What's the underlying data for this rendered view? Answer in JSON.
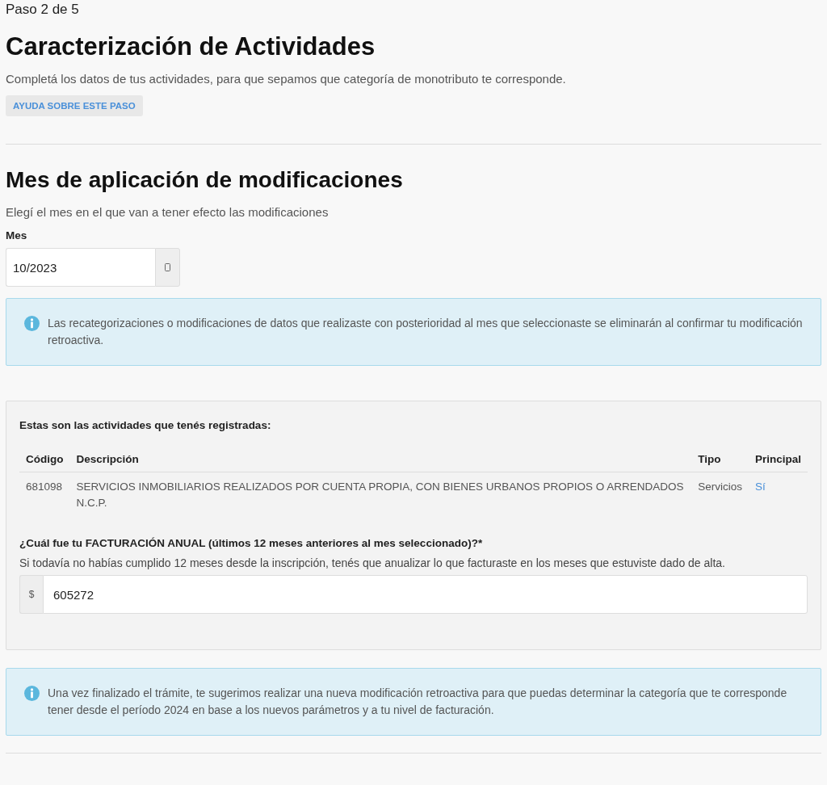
{
  "step": "Paso 2 de 5",
  "title": "Caracterización de Actividades",
  "intro": "Completá los datos de tus actividades, para que sepamos que categoría de monotributo te corresponde.",
  "help_button": "AYUDA SOBRE ESTE PASO",
  "month_section": {
    "title": "Mes de aplicación de modificaciones",
    "description": "Elegí el mes en el que van a tener efecto las modificaciones",
    "field": {
      "label": "Mes",
      "value": "10/2023"
    },
    "alert": "Las recategorizaciones o modificaciones de datos que realizaste con posterioridad al mes que seleccionaste se eliminarán al confirmar tu modificación retroactiva."
  },
  "activities": {
    "title": "Estas son las actividades que tenés registradas:",
    "table": {
      "columns": [
        "Código",
        "Descripción",
        "Tipo",
        "Principal"
      ],
      "rows": [
        [
          "681098",
          "SERVICIOS INMOBILIARIOS REALIZADOS POR CUENTA PROPIA, CON BIENES URBANOS PROPIOS O ARRENDADOS N.C.P.",
          "Servicios",
          "Sí"
        ]
      ]
    },
    "billing": {
      "question": "¿Cuál fue tu FACTURACIÓN ANUAL (últimos 12 meses anteriores al mes seleccionado)?*",
      "hint": "Si todavía no habías cumplido 12 meses desde la inscripción, tenés que anualizar lo que facturaste en los meses que estuviste dado de alta.",
      "prefix": "$",
      "value": "605272"
    }
  },
  "final_alert": "Una vez finalizado el trámite, te sugerimos realizar una nueva modificación retroactiva para que puedas determinar la categoría que te corresponde tener desde el período 2024 en base a los nuevos parámetros y a tu nivel de facturación."
}
